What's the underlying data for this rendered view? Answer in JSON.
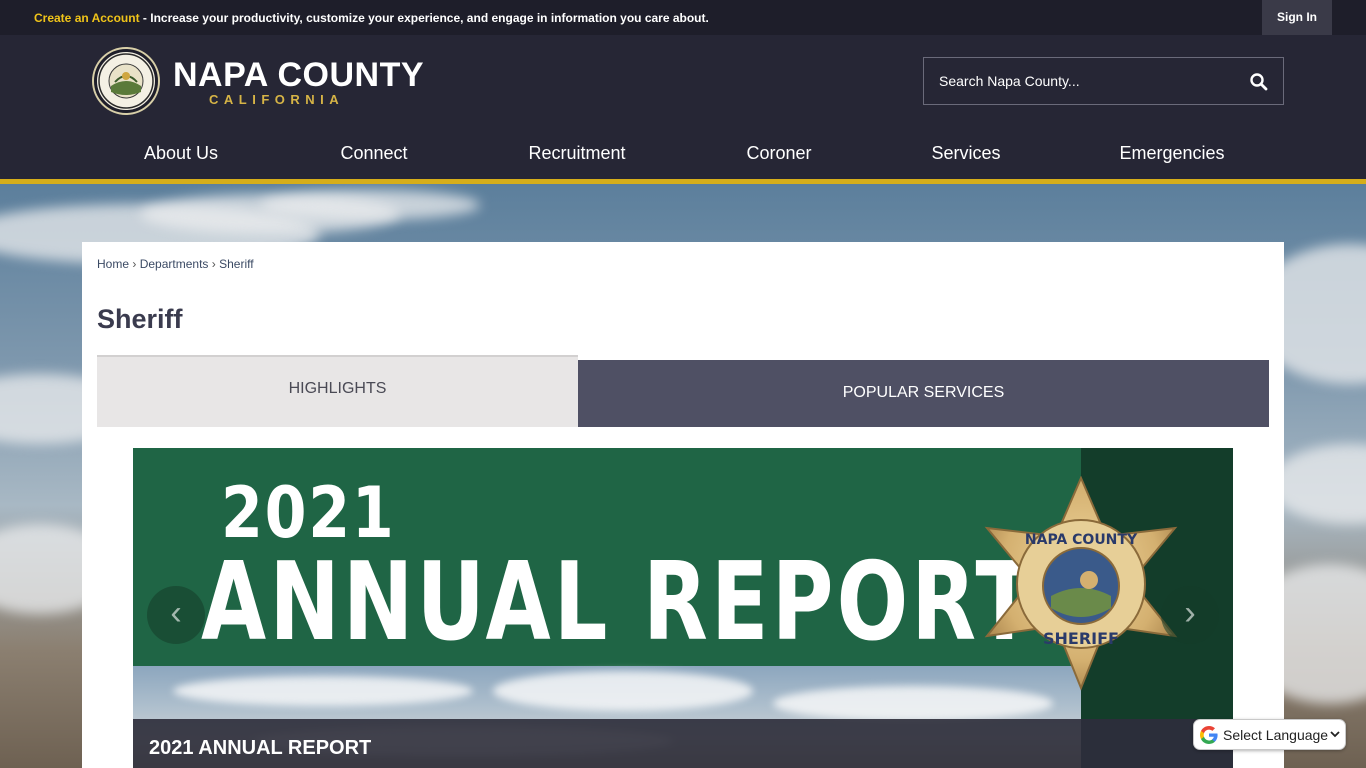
{
  "topbar": {
    "create_account": "Create an Account",
    "message": " - Increase your productivity, customize your experience, and engage in information you care about.",
    "sign_in": "Sign In"
  },
  "header": {
    "title": "NAPA COUNTY",
    "subtitle": "CALIFORNIA",
    "search_placeholder": "Search Napa County..."
  },
  "nav": {
    "items": [
      "About Us",
      "Connect",
      "Recruitment",
      "Coroner",
      "Services",
      "Emergencies"
    ]
  },
  "breadcrumb": {
    "home": "Home",
    "departments": "Departments",
    "current": "Sheriff"
  },
  "page": {
    "title": "Sheriff"
  },
  "tabs": {
    "highlights": "HIGHLIGHTS",
    "popular": "POPULAR SERVICES"
  },
  "slide": {
    "year": "2021",
    "headline": "ANNUAL REPORT",
    "caption": "2021 ANNUAL REPORT",
    "badge_top": "NAPA COUNTY",
    "badge_bottom": "SHERIFF"
  },
  "translate": {
    "label": "Select Language"
  },
  "colors": {
    "header_bg": "#262635",
    "accent_gold": "#d6ae1a",
    "tab_active_bg": "#4f5064",
    "slide_green": "#1f6545"
  }
}
